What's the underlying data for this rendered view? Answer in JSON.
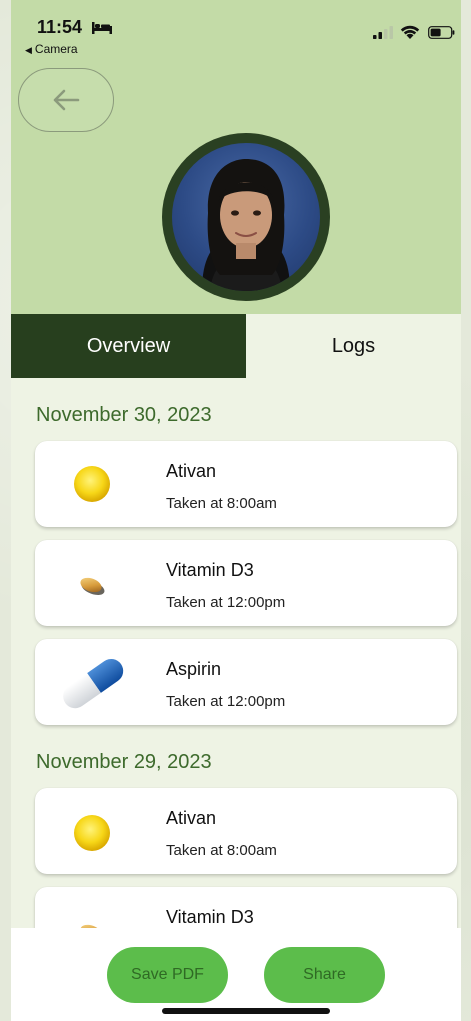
{
  "status_bar": {
    "time": "11:54",
    "back_app_label": "Camera",
    "icons": [
      "bed-icon",
      "signal-icon",
      "wifi-icon",
      "battery-icon"
    ]
  },
  "header": {
    "back_icon": "arrow-left-icon",
    "avatar": "profile-photo"
  },
  "tabs": [
    {
      "label": "Overview",
      "active": true
    },
    {
      "label": "Logs",
      "active": false
    }
  ],
  "log_groups": [
    {
      "date": "November 30, 2023",
      "entries": [
        {
          "name": "Ativan",
          "taken": "Taken at 8:00am",
          "icon": "yellow-round-pill-icon"
        },
        {
          "name": "Vitamin D3",
          "taken": "Taken at 12:00pm",
          "icon": "softgel-pill-icon"
        },
        {
          "name": "Aspirin",
          "taken": "Taken at 12:00pm",
          "icon": "capsule-pill-icon"
        }
      ]
    },
    {
      "date": "November 29, 2023",
      "entries": [
        {
          "name": "Ativan",
          "taken": "Taken at 8:00am",
          "icon": "yellow-round-pill-icon"
        },
        {
          "name": "Vitamin D3",
          "taken": "",
          "icon": "softgel-pill-icon"
        }
      ]
    }
  ],
  "footer": {
    "save_pdf_label": "Save PDF",
    "share_label": "Share"
  },
  "colors": {
    "header_bg": "#c3dba7",
    "tab_active_bg": "#273f1e",
    "date_heading": "#3d6a2c",
    "button_green": "#5cbd4b"
  }
}
